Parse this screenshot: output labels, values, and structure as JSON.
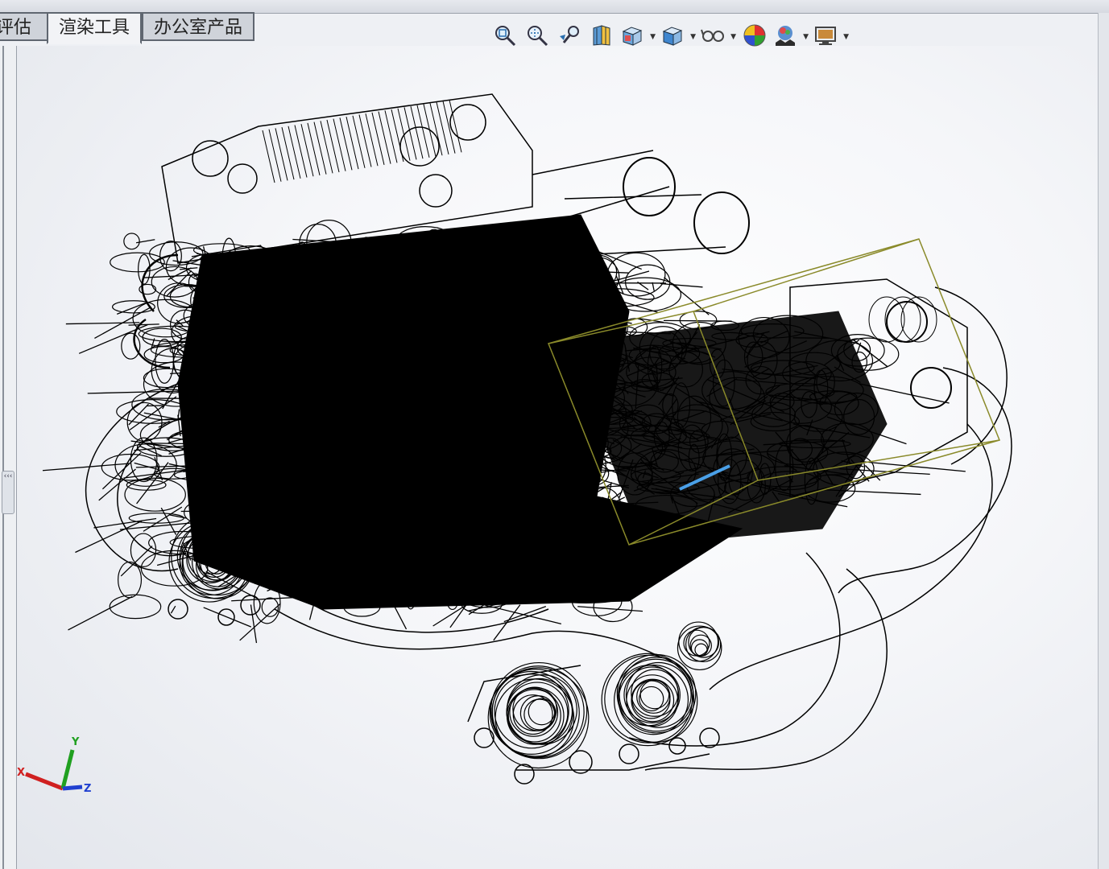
{
  "tabs": [
    {
      "label": "评估",
      "active": false
    },
    {
      "label": "渲染工具",
      "active": true
    },
    {
      "label": "办公室产品",
      "active": false
    }
  ],
  "headsup_toolbar": [
    {
      "icon": "zoom-to-fit-icon",
      "dropdown": false
    },
    {
      "icon": "zoom-to-area-icon",
      "dropdown": false
    },
    {
      "icon": "previous-view-icon",
      "dropdown": false
    },
    {
      "icon": "section-view-icon",
      "dropdown": false
    },
    {
      "icon": "view-orientation-icon",
      "dropdown": true
    },
    {
      "icon": "display-style-icon",
      "dropdown": true
    },
    {
      "icon": "hide-show-items-icon",
      "dropdown": true
    },
    {
      "icon": "edit-appearance-icon",
      "dropdown": false
    },
    {
      "icon": "apply-scene-icon",
      "dropdown": true
    },
    {
      "icon": "view-settings-icon",
      "dropdown": true
    }
  ],
  "triad": {
    "x_label": "X",
    "y_label": "Y",
    "z_label": "Z"
  },
  "colors": {
    "wireframe": "#000000",
    "bounding_box": "#8a8a2a",
    "highlight": "#4aa0e8",
    "axis_x": "#d02020",
    "axis_y": "#20a020",
    "axis_z": "#2040d0"
  },
  "panel_toggle": "‹‹‹"
}
